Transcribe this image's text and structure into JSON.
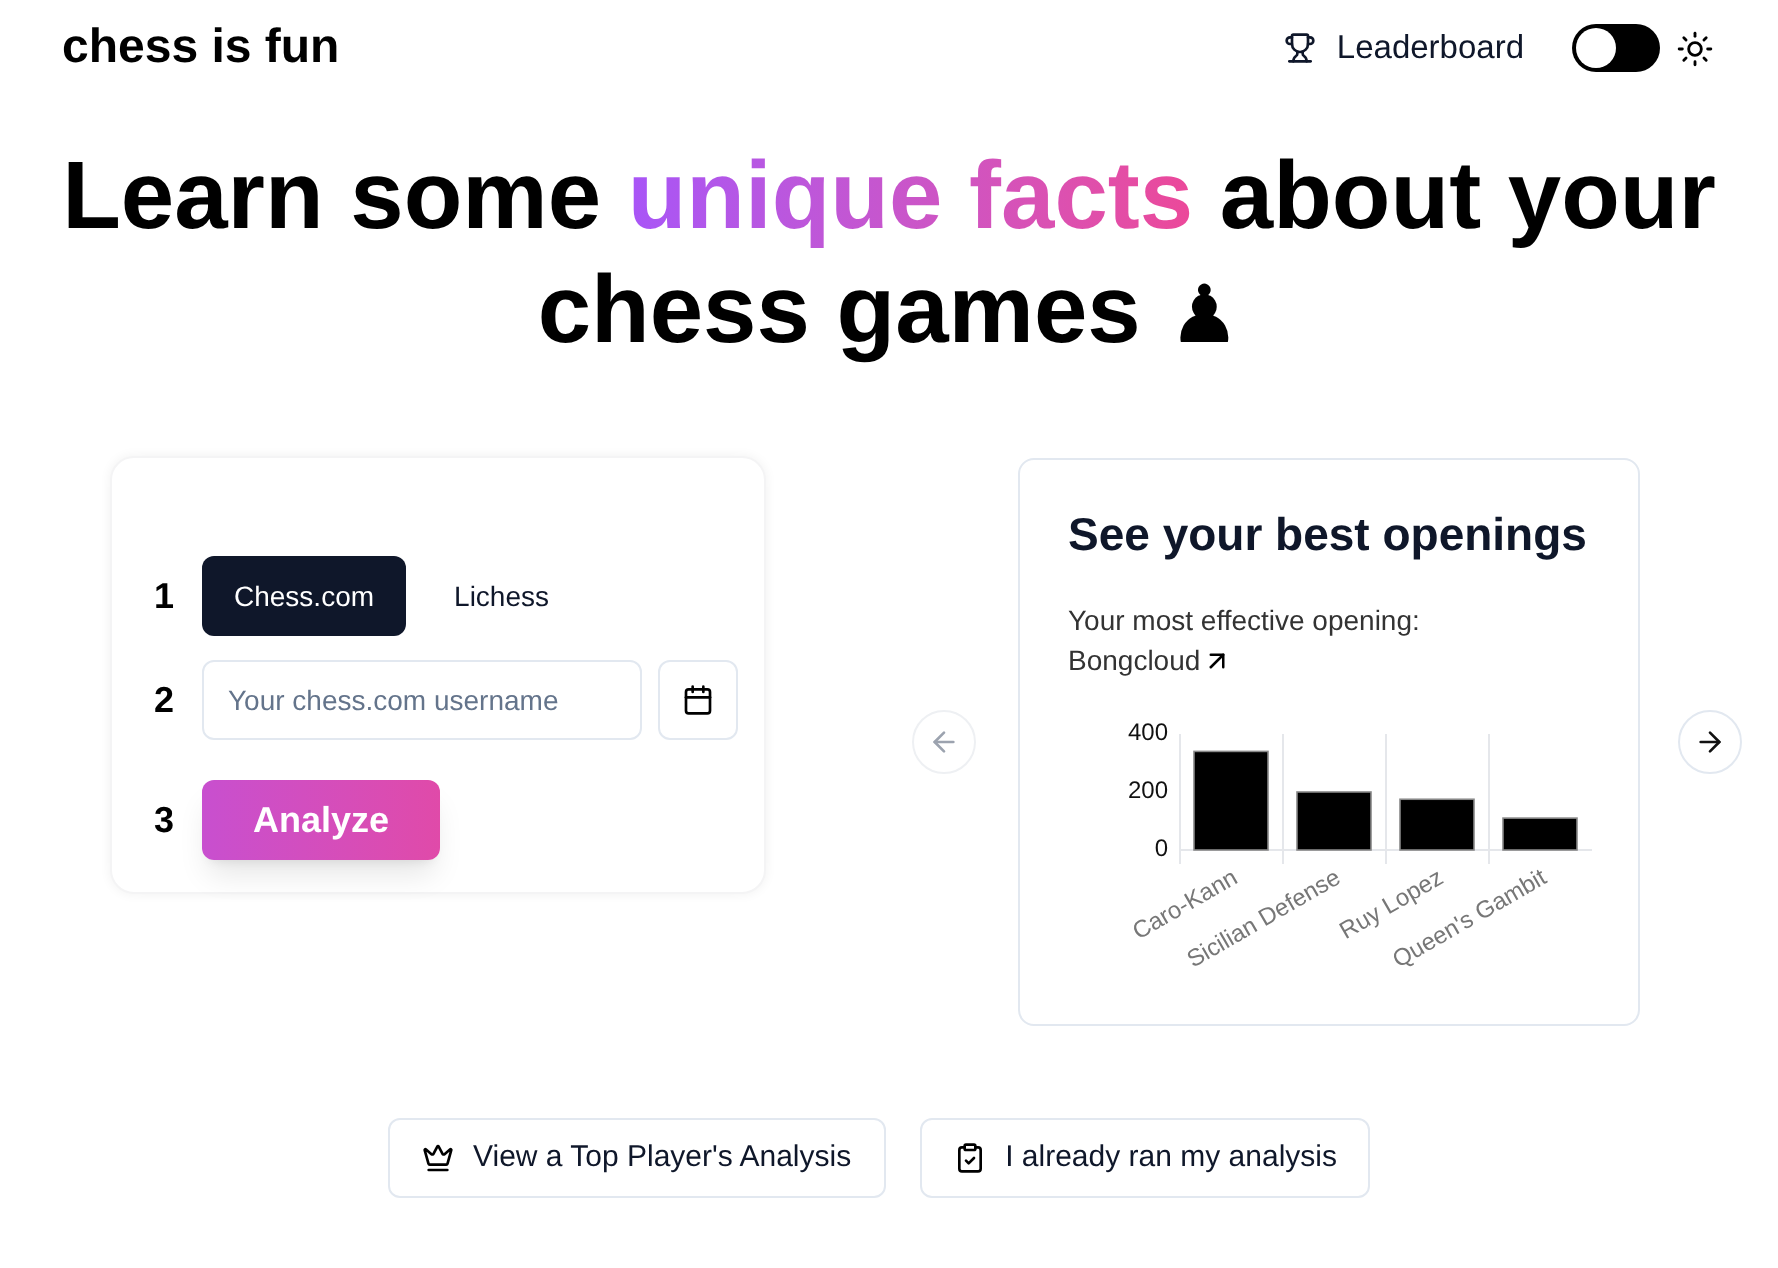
{
  "header": {
    "brand": "chess is fun",
    "leaderboard_link": "Leaderboard",
    "theme_toggle": {
      "on": false
    }
  },
  "headline": {
    "before": "Learn some",
    "highlight": "unique facts",
    "after": "about your chess games",
    "symbol": "♟"
  },
  "analysis_form": {
    "steps": [
      {
        "number": "1",
        "kind": "platform",
        "tabs": [
          {
            "label": "Chess.com",
            "selected": true
          },
          {
            "label": "Lichess",
            "selected": false
          }
        ]
      },
      {
        "number": "2",
        "kind": "username",
        "placeholder": "Your chess.com username"
      },
      {
        "number": "3",
        "kind": "submit",
        "button": "Analyze"
      }
    ]
  },
  "carousel": {
    "prev": {
      "disabled": true
    },
    "next": {
      "disabled": false
    },
    "slide": {
      "title": "See your best openings",
      "subtitle": "Your most effective opening:",
      "link": "Bongcloud",
      "chart_data": {
        "type": "bar",
        "categories": [
          "Caro-Kann",
          "Sicilian Defense",
          "Ruy Lopez",
          "Queen's Gambit"
        ],
        "values": [
          340,
          200,
          175,
          110
        ],
        "ylim": [
          0,
          400
        ],
        "yticks": [
          0,
          200,
          400
        ]
      }
    }
  },
  "bottom_buttons": [
    {
      "label": "View a Top Player's Analysis"
    },
    {
      "label": "I already ran my analysis"
    }
  ]
}
